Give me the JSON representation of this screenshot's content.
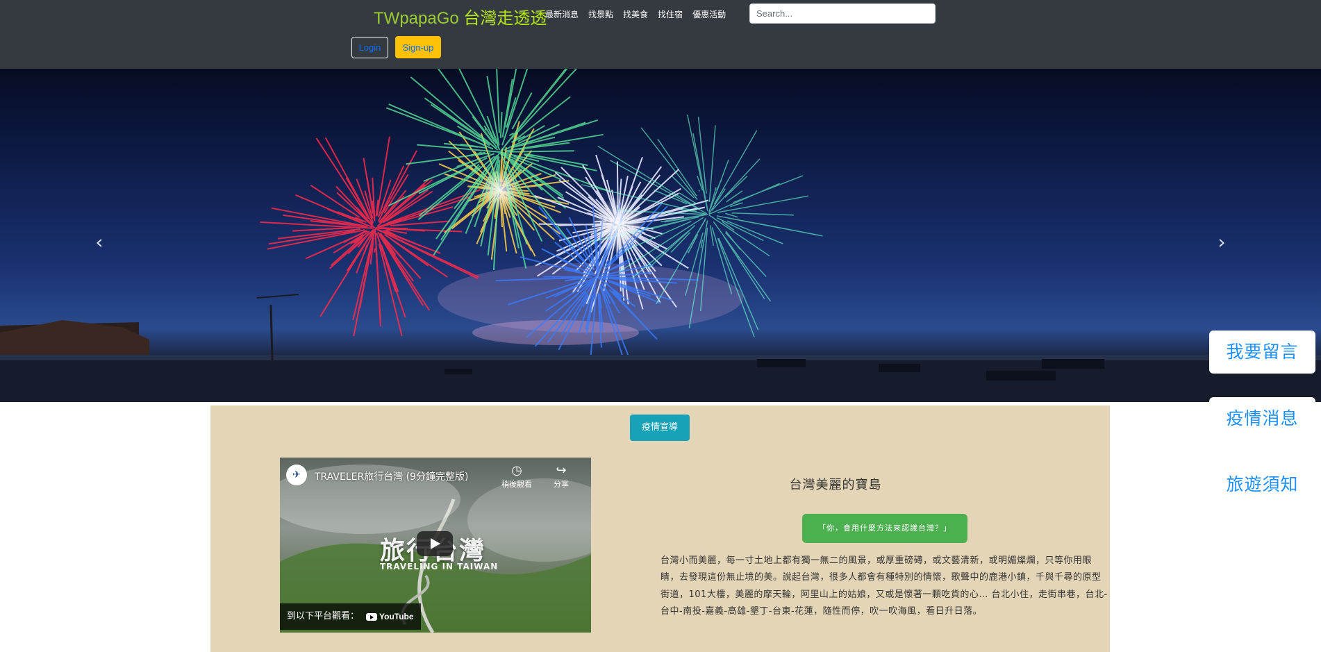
{
  "navbar": {
    "brand_en": "TWpapaGo",
    "brand_cn": "台灣走透透",
    "links": [
      "最新消息",
      "找景點",
      "找美食",
      "找住宿",
      "優惠活動"
    ],
    "search_placeholder": "Search...",
    "login_label": "Login",
    "signup_label": "Sign-up"
  },
  "carousel": {
    "prev_icon": "chevron-left-icon",
    "next_icon": "chevron-right-icon",
    "prev_glyph": "‹",
    "next_glyph": "›"
  },
  "side_buttons": [
    "我要留言",
    "疫情消息",
    "旅遊須知"
  ],
  "content": {
    "epidemic_button": "疫情宣導",
    "video": {
      "title": "TRAVELER旅行台灣 (9分鐘完整版)",
      "watch_later": "稍後觀看",
      "share": "分享",
      "overlay_title": "旅行台灣",
      "overlay_subtitle": "TRAVELING IN TAIWAN",
      "watch_on": "到以下平台觀看：",
      "youtube": "YouTube",
      "channel_glyph": "✈"
    },
    "section_title": "台灣美麗的寶島",
    "question_button": "「你，會用什麼方法來認識台灣？」",
    "description": "台灣小而美麗，每一寸土地上都有獨一無二的風景，或厚重磅礡，或文藝清新，或明媚燦爛，只等你用眼睛，去發現這份無止境的美。說起台灣，很多人都會有種特別的情懷，歌聲中的鹿港小鎮，千與千尋的原型街道，101大樓，美麗的摩天輪，阿里山上的姑娘，又或是懷著一顆吃貨的心… 台北小住，走街串巷，台北-台中-南投-嘉義-高雄-墾丁-台東-花蓮，隨性而停，吹一吹海風，看日升日落。"
  }
}
